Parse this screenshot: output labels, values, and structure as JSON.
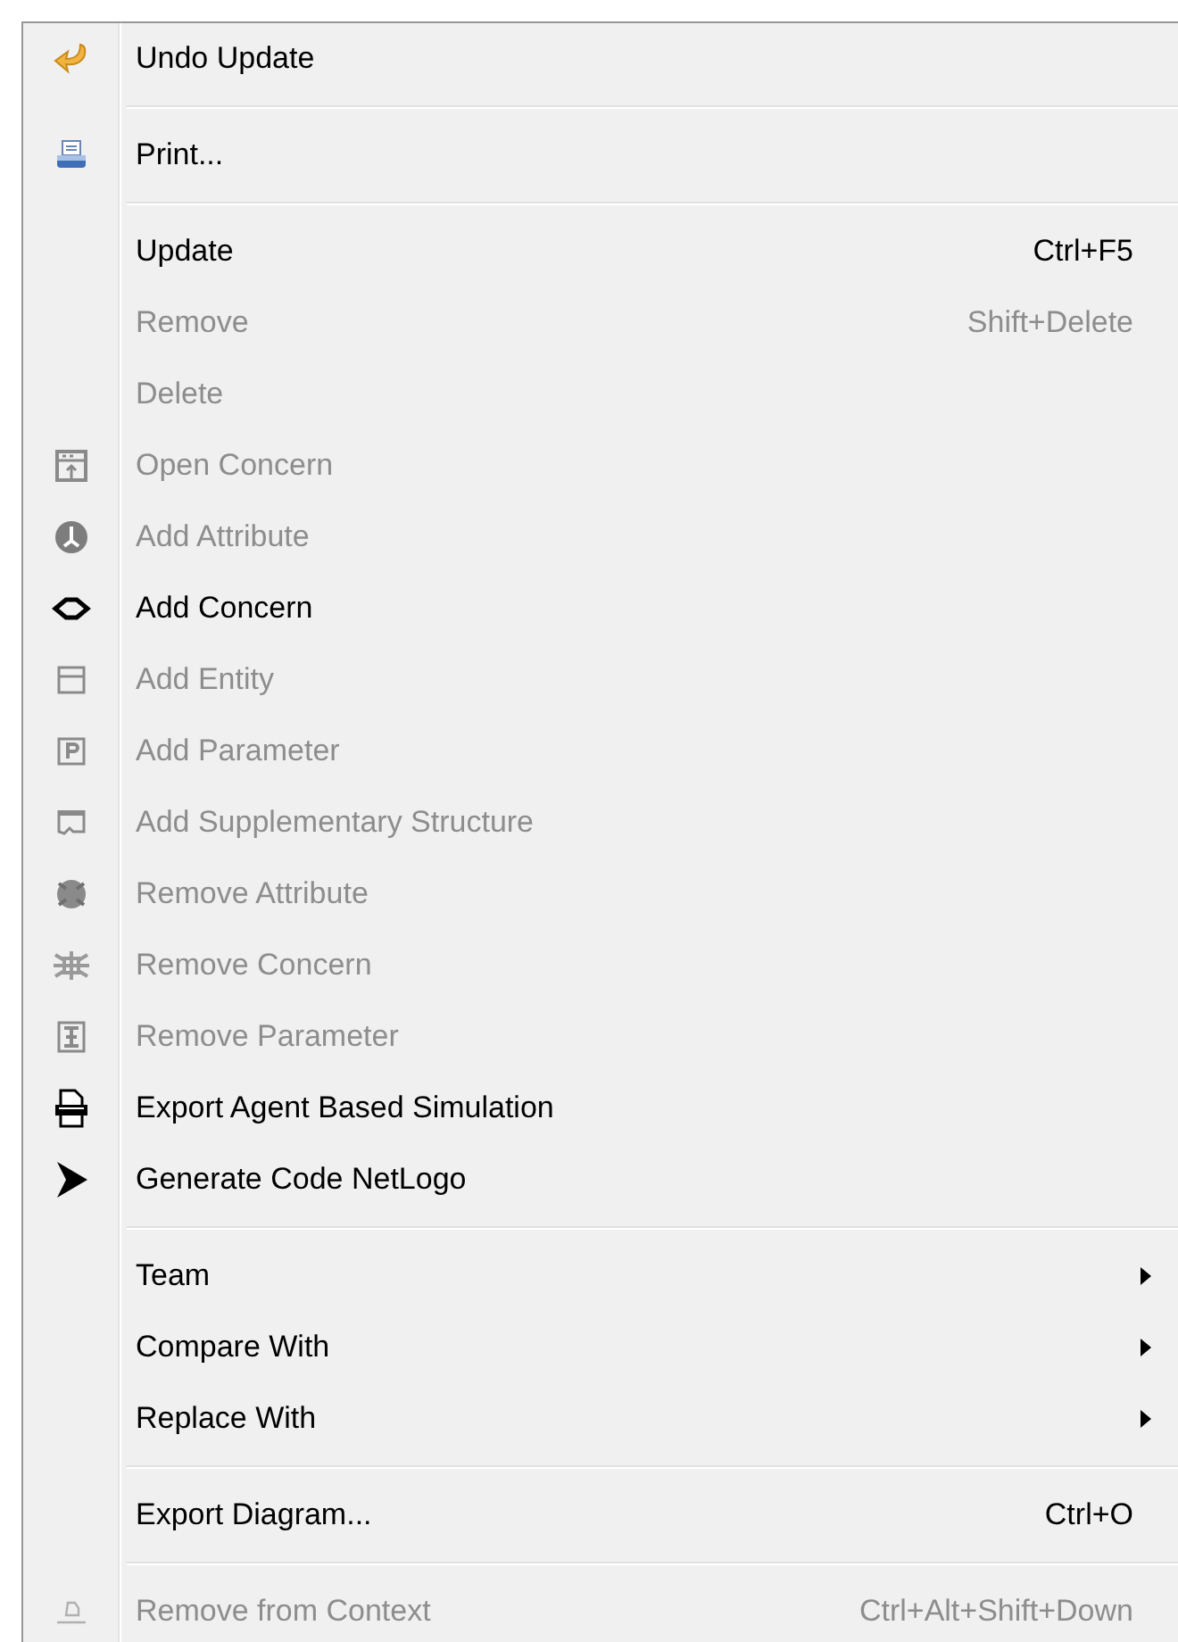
{
  "menu": {
    "items": [
      {
        "kind": "item",
        "label": "Undo Update",
        "disabled": false
      },
      {
        "kind": "separator"
      },
      {
        "kind": "item",
        "label": "Print...",
        "disabled": false
      },
      {
        "kind": "separator"
      },
      {
        "kind": "item",
        "label": "Update",
        "shortcut": "Ctrl+F5",
        "disabled": false
      },
      {
        "kind": "item",
        "label": "Remove",
        "shortcut": "Shift+Delete",
        "disabled": true
      },
      {
        "kind": "item",
        "label": "Delete",
        "disabled": true
      },
      {
        "kind": "item",
        "label": "Open Concern",
        "disabled": true
      },
      {
        "kind": "item",
        "label": "Add Attribute",
        "disabled": true
      },
      {
        "kind": "item",
        "label": "Add Concern",
        "disabled": false
      },
      {
        "kind": "item",
        "label": "Add Entity",
        "disabled": true
      },
      {
        "kind": "item",
        "label": "Add Parameter",
        "disabled": true
      },
      {
        "kind": "item",
        "label": "Add Supplementary Structure",
        "disabled": true
      },
      {
        "kind": "item",
        "label": "Remove Attribute",
        "disabled": true
      },
      {
        "kind": "item",
        "label": "Remove Concern",
        "disabled": true
      },
      {
        "kind": "item",
        "label": "Remove Parameter",
        "disabled": true
      },
      {
        "kind": "item",
        "label": "Export Agent Based Simulation",
        "disabled": false
      },
      {
        "kind": "item",
        "label": "Generate Code NetLogo",
        "disabled": false
      },
      {
        "kind": "separator"
      },
      {
        "kind": "submenu",
        "label": "Team",
        "disabled": false
      },
      {
        "kind": "submenu",
        "label": "Compare With",
        "disabled": false
      },
      {
        "kind": "submenu",
        "label": "Replace With",
        "disabled": false
      },
      {
        "kind": "separator"
      },
      {
        "kind": "item",
        "label": "Export Diagram...",
        "shortcut": "Ctrl+O",
        "disabled": false
      },
      {
        "kind": "separator"
      },
      {
        "kind": "item",
        "label": "Remove from Context",
        "shortcut": "Ctrl+Alt+Shift+Down",
        "disabled": true
      }
    ]
  }
}
